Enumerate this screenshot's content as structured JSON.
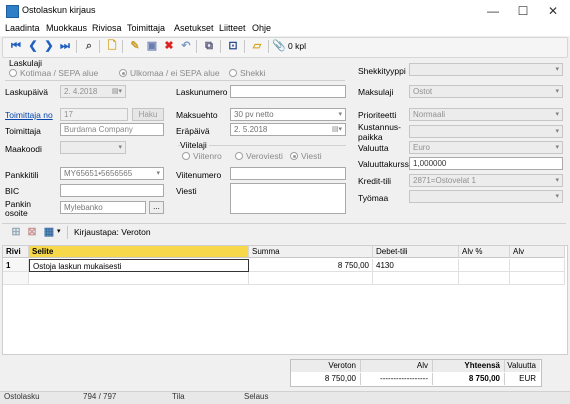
{
  "window": {
    "title": "Ostolaskun kirjaus",
    "minimize": "—",
    "maximize": "☐",
    "close": "✕"
  },
  "menu": [
    "Laadinta",
    "Muokkaus",
    "Riviosa",
    "Toimittaja",
    "Asetukset",
    "Liitteet",
    "Ohje"
  ],
  "toolbar": {
    "attachments_count": "0 kpl"
  },
  "laskulaji": {
    "label": "Laskulaji",
    "options": [
      "Kotimaa / SEPA alue",
      "Ulkomaa / ei SEPA alue",
      "Shekki"
    ],
    "selected": "Ulkomaa / ei SEPA alue"
  },
  "form": {
    "laskupaiva_label": "Laskupäivä",
    "laskupaiva_value": "2. 4.2018",
    "laskunumero_label": "Laskunumero",
    "laskunumero_value": "",
    "toimittaja_no_label": "Toimittaja no",
    "toimittaja_no_value": "17",
    "haku_label": "Haku",
    "toimittaja_label": "Toimittaja",
    "toimittaja_value": "Burdama Company",
    "maakoodi_label": "Maakoodi",
    "maakoodi_value": "",
    "maksuehto_label": "Maksuehto",
    "maksuehto_value": "30 pv netto",
    "erapaiva_label": "Eräpäivä",
    "erapaiva_value": "2. 5.2018",
    "viitelaji_label": "Viitelaji",
    "viitelaji_options": [
      "Viitenro",
      "Veroviesti",
      "Viesti"
    ],
    "viitelaji_selected": "Viesti",
    "pankkitili_label": "Pankkitili",
    "pankkitili_value": "MY65651•5656565",
    "bic_label": "BIC",
    "bic_value": "",
    "pankin_osoite_label_1": "Pankin",
    "pankin_osoite_label_2": "osoite",
    "pankin_osoite_value": "Mylebanko",
    "pankin_osoite_button": "...",
    "viitenumero_label": "Viitenumero",
    "viitenumero_value": "",
    "viesti_label": "Viesti",
    "viesti_value": "",
    "shekkityyppi_label": "Shekkityyppi",
    "shekkityyppi_value": "",
    "maksulaji_label": "Maksulaji",
    "maksulaji_value": "Ostot",
    "prioriteetti_label": "Prioriteetti",
    "prioriteetti_value": "Normaali",
    "kustannuspaikka_label_1": "Kustannus-",
    "kustannuspaikka_label_2": "paikka",
    "kustannuspaikka_value": "",
    "valuutta_label": "Valuutta",
    "valuutta_value": "Euro",
    "valuuttakurssi_label": "Valuuttakurssi",
    "valuuttakurssi_value": "1,000000",
    "kredit_tili_label": "Kredit-tili",
    "kredit_tili_value": "2871=Ostovelat 1",
    "tyomaa_label": "Työmaa",
    "tyomaa_value": ""
  },
  "grid_toolbar": {
    "kirjaustapa": "Kirjaustapa: Veroton"
  },
  "grid": {
    "columns": [
      "Rivi",
      "Selite",
      "Summa",
      "Debet-tili",
      "Alv %",
      "Alv"
    ],
    "rows": [
      {
        "rivi": "1",
        "selite": "Ostoja laskun mukaisesti",
        "summa": "8 750,00",
        "debet": "4130",
        "alv_pct": "",
        "alv": ""
      }
    ]
  },
  "totals": {
    "headers": [
      "Veroton",
      "Alv",
      "Yhteensä",
      "Valuutta"
    ],
    "values": [
      "8 750,00",
      "------------------",
      "8 750,00",
      "EUR"
    ]
  },
  "status": {
    "mode": "Ostolasku",
    "position": "794 / 797",
    "tila": "Tila",
    "selaus": "Selaus"
  }
}
